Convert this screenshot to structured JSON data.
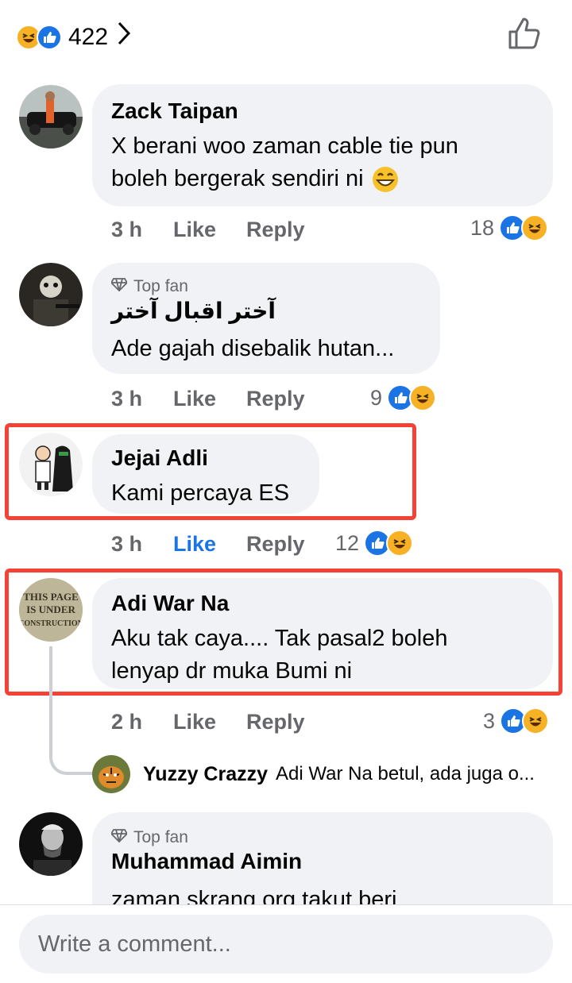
{
  "reactions_summary": {
    "count": "422",
    "icons": [
      "haha-icon",
      "like-icon"
    ]
  },
  "comments": [
    {
      "name": "Zack Taipan",
      "text_line1": "X berani woo zaman cable tie pun",
      "text_line2": "boleh bergerak sendiri ni",
      "emoji": "grinning-face-icon",
      "time": "3 h",
      "like_label": "Like",
      "reply_label": "Reply",
      "reaction_count": "18"
    },
    {
      "badge": "Top fan",
      "name": "آختر اقبال آختر",
      "text_line1": "Ade gajah disebalik hutan...",
      "time": "3 h",
      "like_label": "Like",
      "reply_label": "Reply",
      "reaction_count": "9"
    },
    {
      "name": "Jejai Adli",
      "text_line1": "Kami percaya ES",
      "time": "3 h",
      "like_label": "Like",
      "liked": true,
      "reply_label": "Reply",
      "reaction_count": "12"
    },
    {
      "name": "Adi War Na",
      "text_line1": "Aku tak caya.... Tak pasal2 boleh",
      "text_line2": "lenyap dr muka Bumi ni",
      "time": "2 h",
      "like_label": "Like",
      "reply_label": "Reply",
      "reaction_count": "3",
      "avatar_text": "THIS PAGE IS UNDER CONSTRUCTION"
    },
    {
      "badge": "Top fan",
      "name": "Muhammad Aimin",
      "text_line1": "zaman skrang org takut beri"
    }
  ],
  "reply_preview": {
    "name": "Yuzzy Crazzy",
    "text": "Adi War Na betul, ada juga o..."
  },
  "composer": {
    "placeholder": "Write a comment..."
  },
  "colors": {
    "like_blue": "#1b74e4",
    "haha_yellow": "#f7b125",
    "bubble": "#f0f2f5",
    "meta_gray": "#65676b",
    "highlight_red": "#f44336"
  }
}
